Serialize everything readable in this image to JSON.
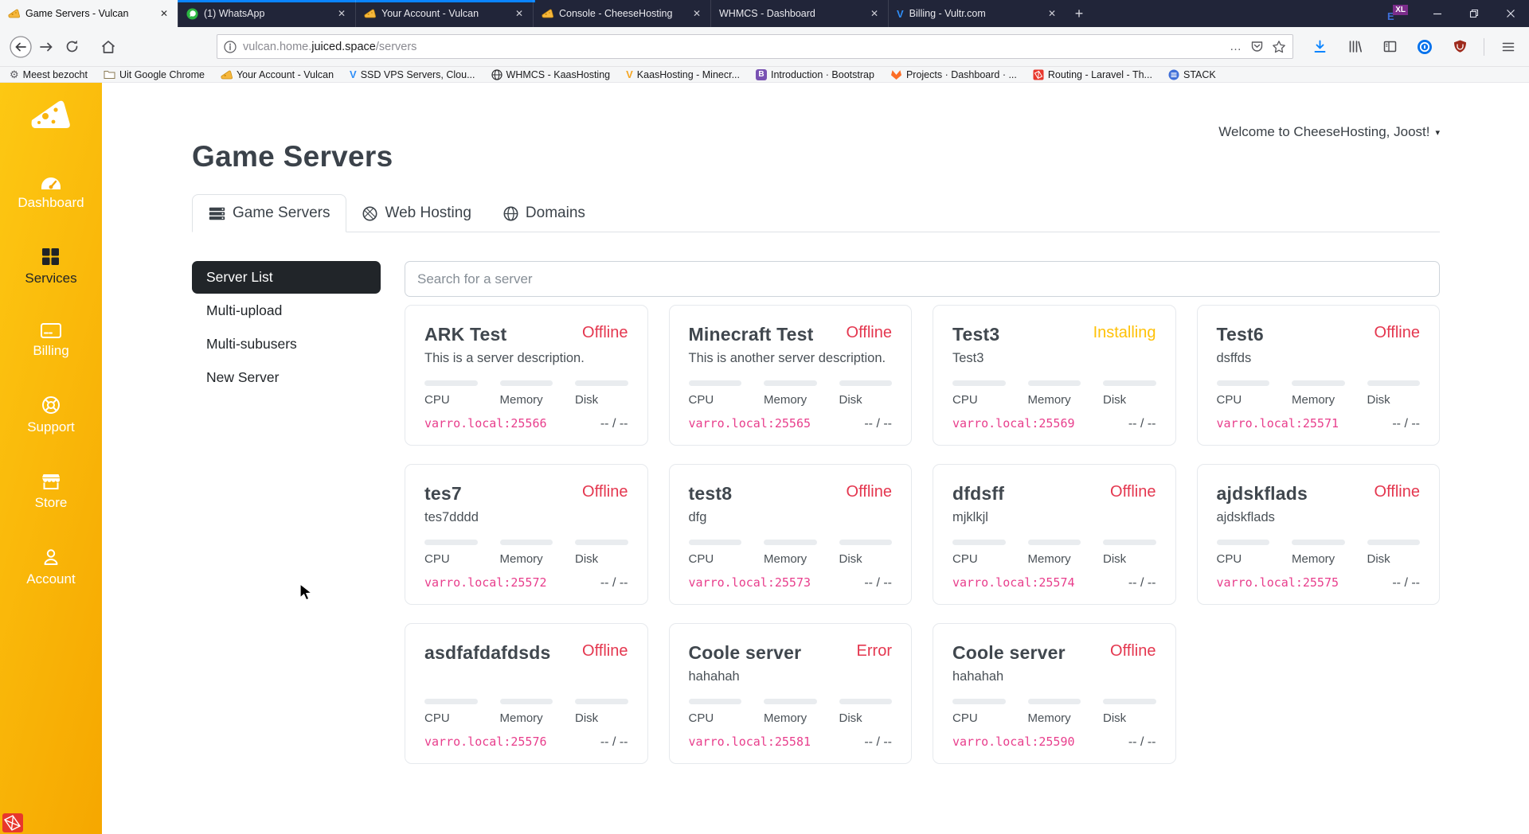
{
  "glyphs": {
    "close": "✕",
    "plus": "+",
    "dots": "…",
    "caret": "▾",
    "vultr": "V",
    "kaas": "V",
    "bootstrap": "B",
    "gear": "⚙"
  },
  "browser": {
    "tabs": [
      {
        "title": "Game Servers - Vulcan"
      },
      {
        "title": "(1) WhatsApp"
      },
      {
        "title": "Your Account - Vulcan"
      },
      {
        "title": "Console - CheeseHosting"
      },
      {
        "title": "WHMCS - Dashboard"
      },
      {
        "title": "Billing - Vultr.com"
      }
    ],
    "url": {
      "prefix": "vulcan.home.",
      "host": "juiced.space",
      "path": "/servers"
    },
    "bookmarks": [
      {
        "label": "Meest bezocht"
      },
      {
        "label": "Uit Google Chrome"
      },
      {
        "label": "Your Account - Vulcan"
      },
      {
        "label": "SSD VPS Servers, Clou..."
      },
      {
        "label": "WHMCS - KaasHosting"
      },
      {
        "label": "KaasHosting - Minecr..."
      },
      {
        "label": "Introduction · Bootstrap"
      },
      {
        "label": "Projects · Dashboard · ..."
      },
      {
        "label": "Routing - Laravel - Th..."
      },
      {
        "label": "STACK"
      }
    ]
  },
  "sidebar": {
    "items": [
      {
        "label": "Dashboard"
      },
      {
        "label": "Services"
      },
      {
        "label": "Billing"
      },
      {
        "label": "Support"
      },
      {
        "label": "Store"
      },
      {
        "label": "Account"
      }
    ]
  },
  "main": {
    "welcome": "Welcome to CheeseHosting, Joost!",
    "heading": "Game Servers",
    "tabs": [
      {
        "label": "Game Servers"
      },
      {
        "label": "Web Hosting"
      },
      {
        "label": "Domains"
      }
    ],
    "nav": [
      {
        "label": "Server List"
      },
      {
        "label": "Multi-upload"
      },
      {
        "label": "Multi-subusers"
      },
      {
        "label": "New Server"
      }
    ],
    "search_placeholder": "Search for a server",
    "card_labels": [
      "CPU",
      "Memory",
      "Disk"
    ],
    "usage_placeholder": "-- / --",
    "status_colors": {
      "Offline": "#e4374f",
      "Installing": "#ffc107",
      "Error": "#e4374f"
    },
    "cards": [
      {
        "name": "ARK Test",
        "status": "Offline",
        "description": "This is a server description.",
        "address": "varro.local:25566"
      },
      {
        "name": "Minecraft Test",
        "status": "Offline",
        "description": "This is another server description.",
        "address": "varro.local:25565"
      },
      {
        "name": "Test3",
        "status": "Installing",
        "description": "Test3",
        "address": "varro.local:25569"
      },
      {
        "name": "Test6",
        "status": "Offline",
        "description": "dsffds",
        "address": "varro.local:25571"
      },
      {
        "name": "tes7",
        "status": "Offline",
        "description": "tes7dddd",
        "address": "varro.local:25572"
      },
      {
        "name": "test8",
        "status": "Offline",
        "description": "dfg",
        "address": "varro.local:25573"
      },
      {
        "name": "dfdsff",
        "status": "Offline",
        "description": "mjklkjl",
        "address": "varro.local:25574"
      },
      {
        "name": "ajdskflads",
        "status": "Offline",
        "description": "ajdskflads",
        "address": "varro.local:25575"
      },
      {
        "name": "asdfafdafdsds",
        "status": "Offline",
        "description": "",
        "address": "varro.local:25576"
      },
      {
        "name": "Coole server",
        "status": "Error",
        "description": "hahahah",
        "address": "varro.local:25581"
      },
      {
        "name": "Coole server",
        "status": "Offline",
        "description": "hahahah",
        "address": "varro.local:25590"
      }
    ]
  }
}
